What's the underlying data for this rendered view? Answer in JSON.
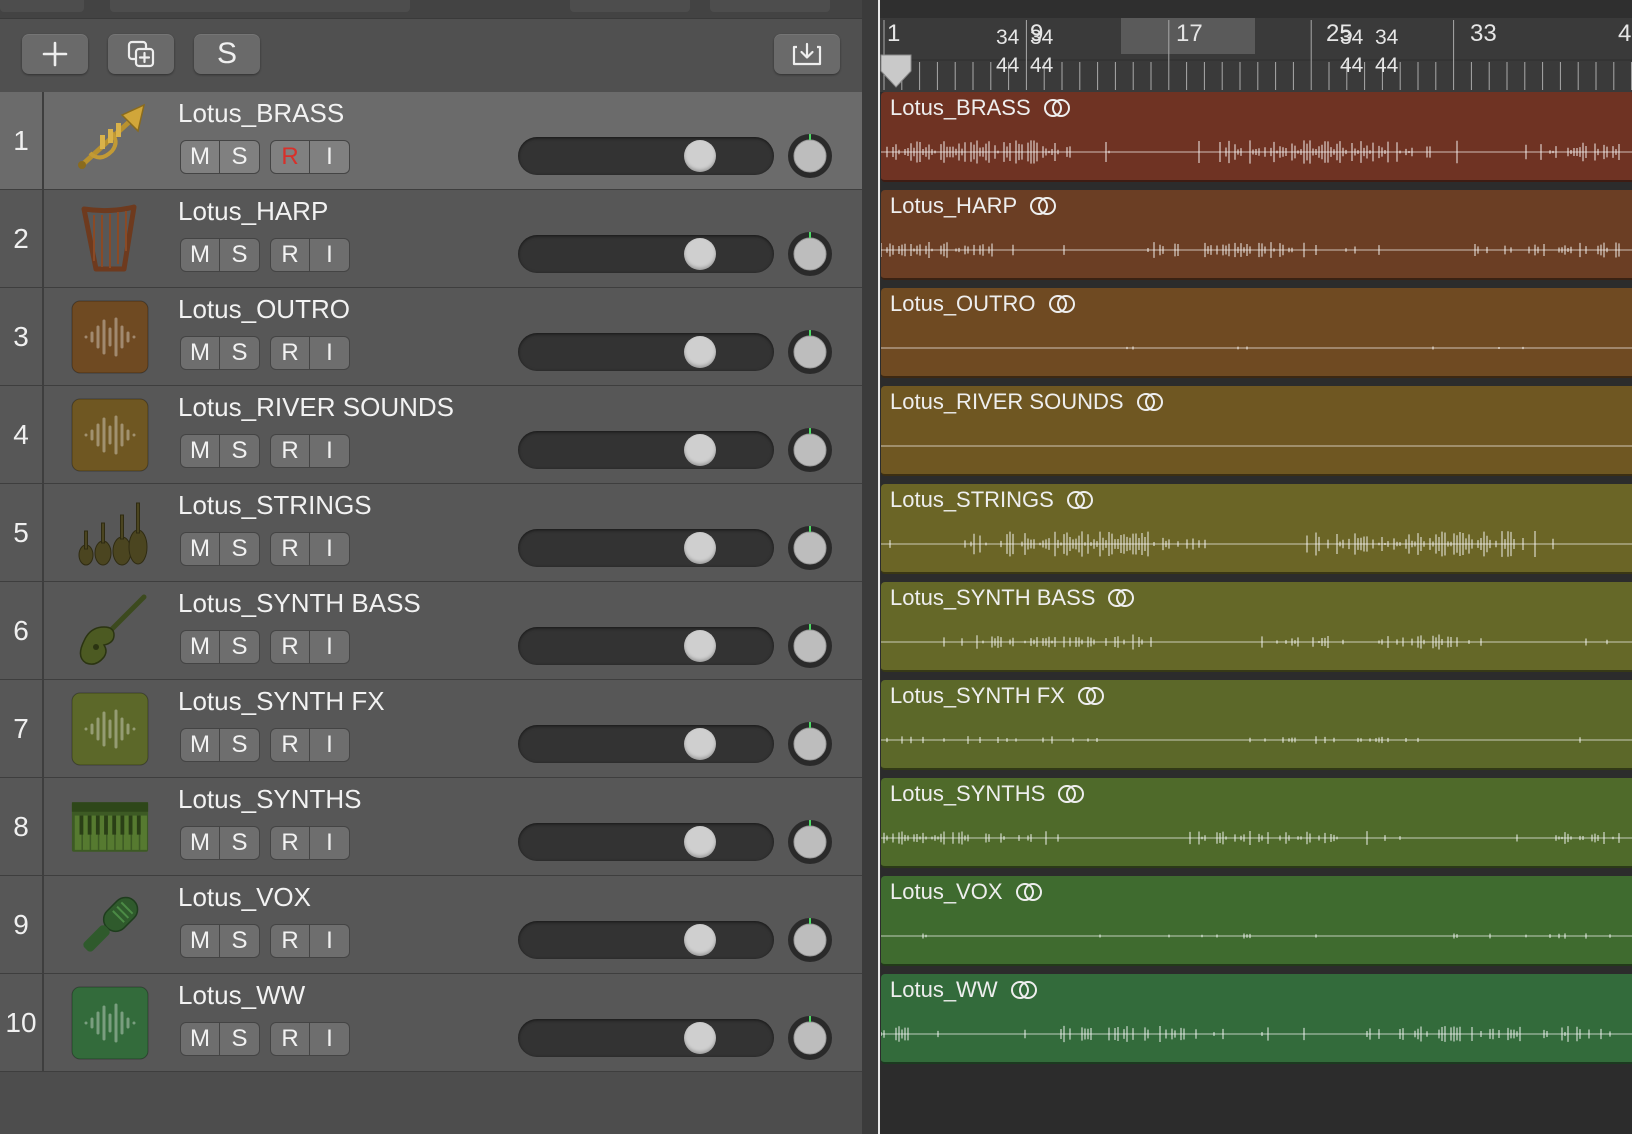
{
  "header": {
    "add_label": "+",
    "duplicate_label": "duplicate",
    "solo_label": "S",
    "download_label": "download"
  },
  "ruler": {
    "bars": [
      "1",
      "9",
      "17",
      "25",
      "33",
      "4"
    ],
    "signatures": [
      {
        "top": "34",
        "bottom": "44"
      },
      {
        "top": "34",
        "bottom": "44"
      },
      {
        "top": "34",
        "bottom": "44"
      },
      {
        "top": "34",
        "bottom": "44"
      }
    ]
  },
  "buttons": {
    "mute": "M",
    "solo": "S",
    "record": "R",
    "input": "I"
  },
  "tracks": [
    {
      "number": "1",
      "name": "Lotus_BRASS",
      "icon": "trumpet-icon",
      "color": "#6f3323",
      "selected": true,
      "record_armed": true
    },
    {
      "number": "2",
      "name": "Lotus_HARP",
      "icon": "harp-icon",
      "color": "#6b3e24",
      "selected": false,
      "record_armed": false
    },
    {
      "number": "3",
      "name": "Lotus_OUTRO",
      "icon": "waveform-icon",
      "color": "#6f4a22",
      "selected": false,
      "record_armed": false
    },
    {
      "number": "4",
      "name": "Lotus_RIVER SOUNDS",
      "icon": "waveform-icon",
      "color": "#6f5722",
      "selected": false,
      "record_armed": false
    },
    {
      "number": "5",
      "name": "Lotus_STRINGS",
      "icon": "strings-icon",
      "color": "#6b6526",
      "selected": false,
      "record_armed": false
    },
    {
      "number": "6",
      "name": "Lotus_SYNTH BASS",
      "icon": "bass-guitar-icon",
      "color": "#656828",
      "selected": false,
      "record_armed": false
    },
    {
      "number": "7",
      "name": "Lotus_SYNTH FX",
      "icon": "waveform-icon",
      "color": "#5c6829",
      "selected": false,
      "record_armed": false
    },
    {
      "number": "8",
      "name": "Lotus_SYNTHS",
      "icon": "keyboard-icon",
      "color": "#4f6a2a",
      "selected": false,
      "record_armed": false
    },
    {
      "number": "9",
      "name": "Lotus_VOX",
      "icon": "microphone-icon",
      "color": "#3f6b2f",
      "selected": false,
      "record_armed": false
    },
    {
      "number": "10",
      "name": "Lotus_WW",
      "icon": "waveform-icon",
      "color": "#336b3b",
      "selected": false,
      "record_armed": false
    }
  ]
}
